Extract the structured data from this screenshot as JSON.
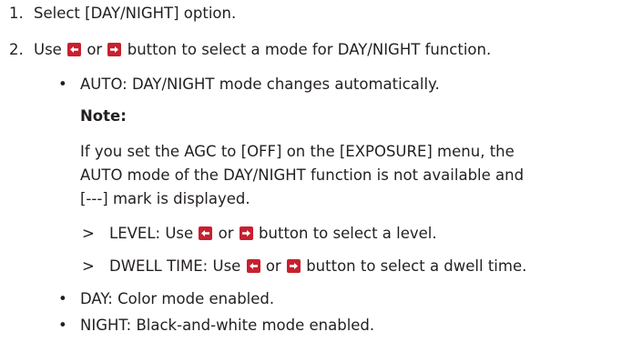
{
  "steps": [
    {
      "number": "1.",
      "text": "Select [DAY/NIGHT] option."
    },
    {
      "number": "2.",
      "text_before": "Use",
      "text_or": "or",
      "text_after": "button to select a mode for DAY/NIGHT function."
    }
  ],
  "bullets": {
    "symbol": "•",
    "auto": "AUTO: DAY/NIGHT mode changes automatically.",
    "note_label": "Note:",
    "note_lines": [
      "If you set the AGC to [OFF] on the [EXPOSURE] menu, the",
      "AUTO mode of the DAY/NIGHT function is not available and",
      "[---] mark is displayed."
    ],
    "sub_symbol": ">",
    "level": {
      "prefix": "LEVEL: Use",
      "or": "or",
      "suffix": "button to select a level."
    },
    "dwell": {
      "prefix": "DWELL TIME: Use",
      "or": "or",
      "suffix": "button to select a dwell time."
    },
    "day": "DAY: Color mode enabled.",
    "night": "NIGHT: Black-and-white mode enabled."
  },
  "icons": {
    "left": "left-arrow-button-icon",
    "right": "right-arrow-button-icon",
    "color": "#c8202f"
  }
}
